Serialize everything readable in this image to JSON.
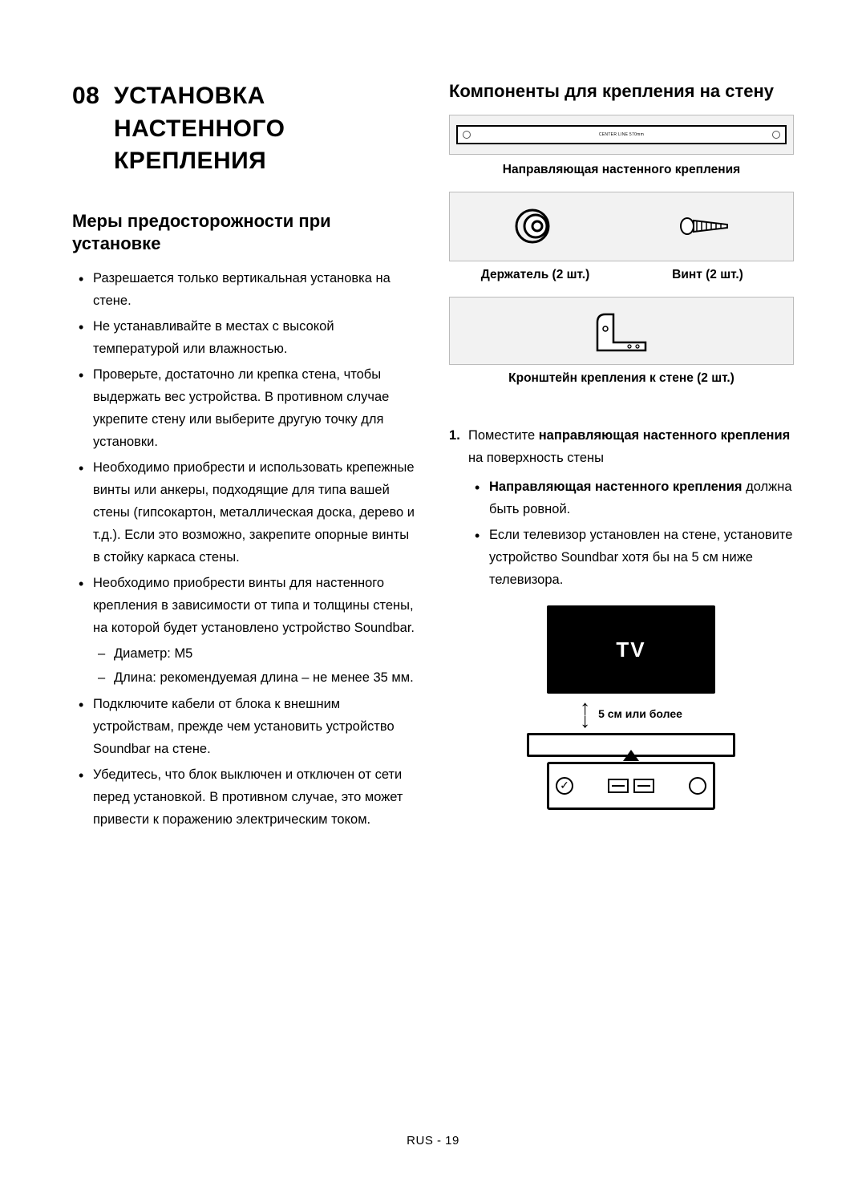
{
  "chapter": {
    "number": "08",
    "title_line1": "УСТАНОВКА",
    "title_line2": "НАСТЕННОГО",
    "title_line3": "КРЕПЛЕНИЯ"
  },
  "left": {
    "heading": "Меры предосторожности при установке",
    "bullets": [
      "Разрешается только вертикальная установка на стене.",
      "Не устанавливайте в местах с высокой температурой или влажностью.",
      "Проверьте, достаточно ли крепка стена, чтобы выдержать вес устройства. В противном случае укрепите стену или выберите другую точку для установки.",
      "Необходимо приобрести и использовать крепежные винты или анкеры, подходящие для типа вашей стены (гипсокартон, металлическая доска, дерево и т.д.). Если это возможно, закрепите опорные винты в стойку каркаса стены.",
      "Необходимо приобрести винты для настенного крепления в зависимости от типа и толщины стены, на которой будет установлено устройство Soundbar.",
      "Подключите кабели от блока к внешним устройствам, прежде чем установить устройство Soundbar на стене.",
      "Убедитесь, что блок выключен и отключен от сети перед установкой. В противном случае, это может привести к поражению электрическим током."
    ],
    "dashes": [
      "Диаметр: M5",
      "Длина: рекомендуемая длина – не менее 35 мм."
    ]
  },
  "right": {
    "heading": "Компоненты для крепления на стену",
    "caption_guide": "Направляющая настенного крепления",
    "caption_holder": "Держатель (2 шт.)",
    "caption_screw": "Винт (2 шт.)",
    "caption_bracket": "Кронштейн крепления к стене (2 шт.)",
    "step1_pre": "Поместите ",
    "step1_bold": "направляющая настенного крепления",
    "step1_post": " на поверхность стены",
    "sub_bullet1_bold": "Направляющая настенного крепления",
    "sub_bullet1_post": " должна быть ровной.",
    "sub_bullet2": "Если телевизор установлен на стене, установите устройство Soundbar хотя бы на 5 см ниже телевизора.",
    "tv_label": "TV",
    "gap_label": "5 см или более",
    "guide_center": "CENTER LINE   570mm"
  },
  "footer": "RUS - 19"
}
